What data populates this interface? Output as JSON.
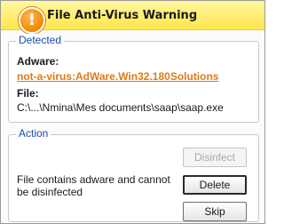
{
  "window": {
    "title": "File Anti-Virus Warning",
    "icon": "warning-icon"
  },
  "detected": {
    "legend": "Detected",
    "threat_label": "Adware:",
    "threat_name": "not-a-virus:AdWare.Win32.180Solutions",
    "file_label": "File:",
    "file_path": "C:\\...\\Nmina\\Mes documents\\saap\\saap.exe"
  },
  "action": {
    "legend": "Action",
    "message": "File contains adware and cannot be disinfected",
    "buttons": {
      "disinfect": "Disinfect",
      "delete": "Delete",
      "skip": "Skip"
    }
  },
  "colors": {
    "titlebar": "#ffe74a",
    "link": "#e07a15",
    "legend": "#1f4ea8"
  }
}
